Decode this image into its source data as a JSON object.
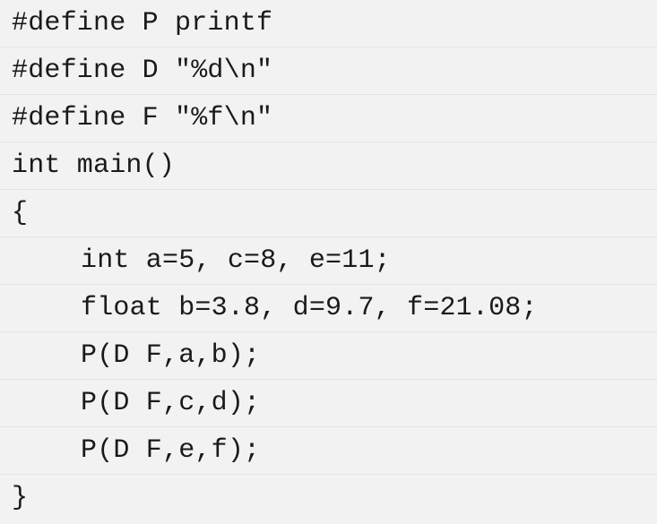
{
  "code": {
    "lines": [
      "#define P printf",
      "#define D \"%d\\n\"",
      "#define F \"%f\\n\"",
      "int main()",
      "{",
      "int a=5, c=8, e=11;",
      "float b=3.8, d=9.7, f=21.08;",
      "P(D F,a,b);",
      "P(D F,c,d);",
      "P(D F,e,f);",
      "}"
    ]
  }
}
